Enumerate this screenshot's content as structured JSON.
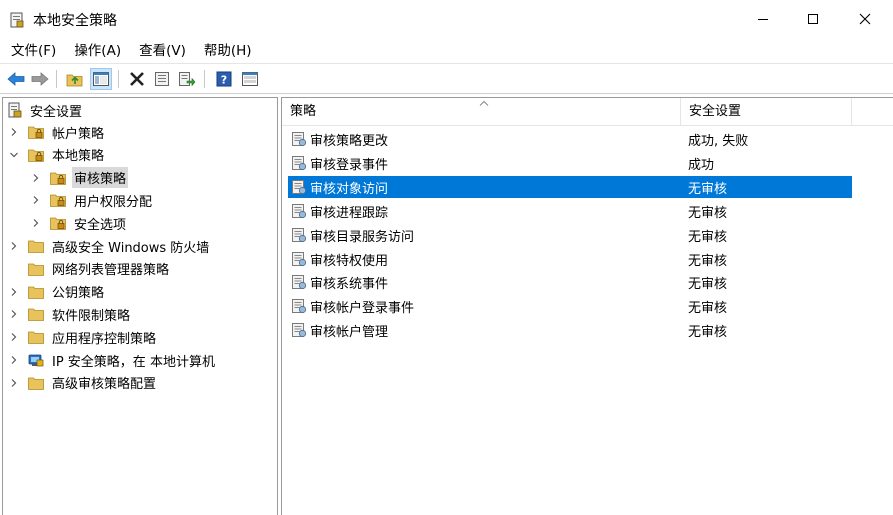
{
  "window": {
    "title": "本地安全策略"
  },
  "menu": [
    "文件(F)",
    "操作(A)",
    "查看(V)",
    "帮助(H)"
  ],
  "toolbar": {
    "buttons": [
      "back-arrow-icon",
      "forward-arrow-icon",
      "up-folder-icon",
      "show-hide-tree-icon",
      "delete-icon",
      "properties-icon",
      "export-list-icon",
      "help-icon",
      "console-icon"
    ]
  },
  "tree": {
    "root": "安全设置",
    "items": [
      {
        "label": "帐户策略",
        "level": 1,
        "expander": "collapsed",
        "icon": "folder-lock-icon"
      },
      {
        "label": "本地策略",
        "level": 1,
        "expander": "expanded",
        "icon": "folder-lock-icon"
      },
      {
        "label": "审核策略",
        "level": 2,
        "expander": "collapsed",
        "icon": "folder-lock-icon",
        "selected": true
      },
      {
        "label": "用户权限分配",
        "level": 2,
        "expander": "collapsed",
        "icon": "folder-lock-icon"
      },
      {
        "label": "安全选项",
        "level": 2,
        "expander": "collapsed",
        "icon": "folder-lock-icon"
      },
      {
        "label": "高级安全 Windows 防火墙",
        "level": 1,
        "expander": "collapsed",
        "icon": "folder-icon"
      },
      {
        "label": "网络列表管理器策略",
        "level": 1,
        "expander": "none",
        "icon": "folder-icon"
      },
      {
        "label": "公钥策略",
        "level": 1,
        "expander": "collapsed",
        "icon": "folder-icon"
      },
      {
        "label": "软件限制策略",
        "level": 1,
        "expander": "collapsed",
        "icon": "folder-icon"
      },
      {
        "label": "应用程序控制策略",
        "level": 1,
        "expander": "collapsed",
        "icon": "folder-icon"
      },
      {
        "label": "IP 安全策略，在 本地计算机",
        "level": 1,
        "expander": "collapsed",
        "icon": "ip-security-icon"
      },
      {
        "label": "高级审核策略配置",
        "level": 1,
        "expander": "collapsed",
        "icon": "folder-icon"
      }
    ]
  },
  "list": {
    "columns": [
      "策略",
      "安全设置"
    ],
    "rows": [
      {
        "policy": "审核策略更改",
        "setting": "成功, 失败"
      },
      {
        "policy": "审核登录事件",
        "setting": "成功"
      },
      {
        "policy": "审核对象访问",
        "setting": "无审核",
        "selected": true
      },
      {
        "policy": "审核进程跟踪",
        "setting": "无审核"
      },
      {
        "policy": "审核目录服务访问",
        "setting": "无审核"
      },
      {
        "policy": "审核特权使用",
        "setting": "无审核"
      },
      {
        "policy": "审核系统事件",
        "setting": "无审核"
      },
      {
        "policy": "审核帐户登录事件",
        "setting": "无审核"
      },
      {
        "policy": "审核帐户管理",
        "setting": "无审核"
      }
    ]
  },
  "colors": {
    "selection": "#0078d7",
    "tree_selection": "#d9d9d9",
    "folder": "#e8c25a"
  }
}
